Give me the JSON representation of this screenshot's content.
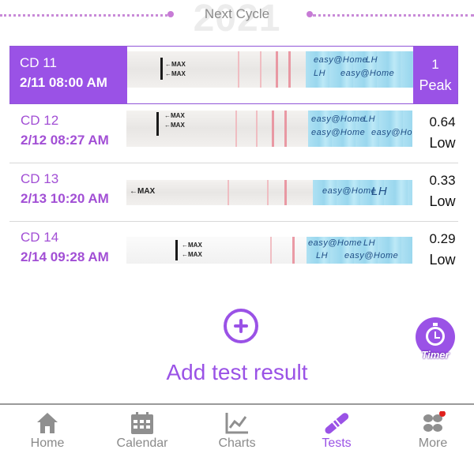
{
  "header": {
    "year": "2021",
    "title": "Next Cycle"
  },
  "rows": [
    {
      "cd": "CD 11",
      "datetime": "2/11  08:00 AM",
      "value": "1",
      "level": "Peak",
      "selected": true
    },
    {
      "cd": "CD 12",
      "datetime": "2/12  08:27 AM",
      "value": "0.64",
      "level": "Low",
      "selected": false
    },
    {
      "cd": "CD 13",
      "datetime": "2/13  10:20 AM",
      "value": "0.33",
      "level": "Low",
      "selected": false
    },
    {
      "cd": "CD 14",
      "datetime": "2/14  09:28 AM",
      "value": "0.29",
      "level": "Low",
      "selected": false
    }
  ],
  "strip_text": {
    "max": "←MAX",
    "brand": "easy@Home",
    "lh": "LH"
  },
  "add": {
    "label": "Add test result"
  },
  "timer": {
    "label": "Timer"
  },
  "nav": {
    "home": "Home",
    "calendar": "Calendar",
    "charts": "Charts",
    "tests": "Tests",
    "more": "More"
  },
  "colors": {
    "accent": "#9a52e6",
    "notification": "#e0201c"
  }
}
